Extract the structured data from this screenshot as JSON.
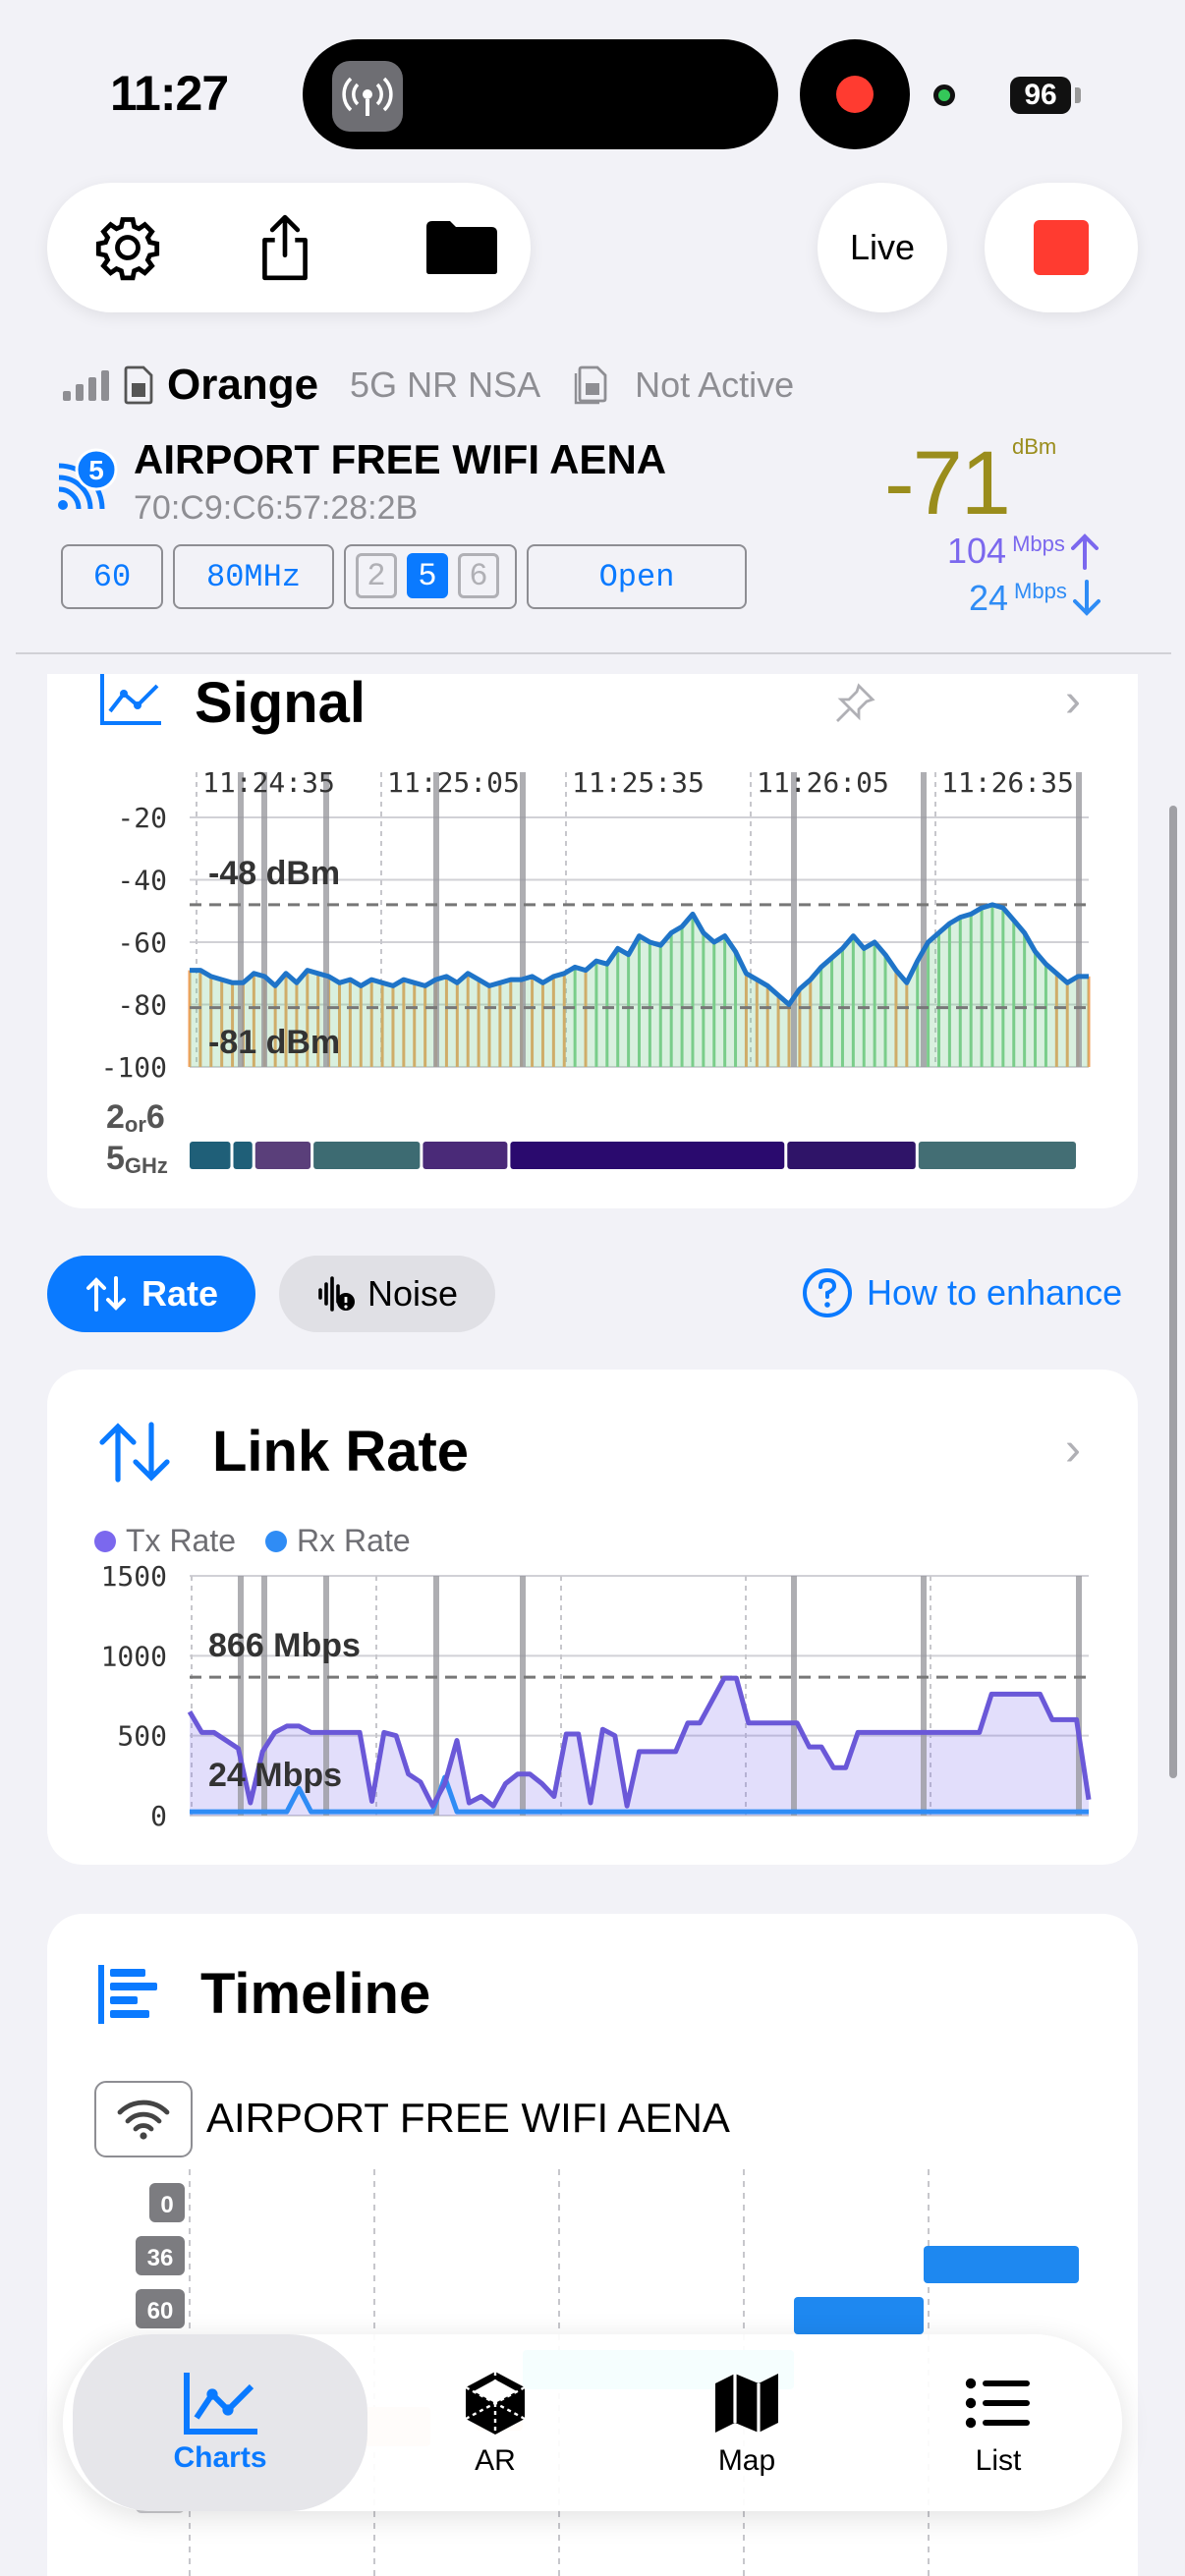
{
  "status_bar": {
    "time": "11:27",
    "battery": "96"
  },
  "toolbar": {
    "settings_icon": "gear-icon",
    "share_icon": "share-icon",
    "folder_icon": "folder-icon",
    "live_label": "Live",
    "stop_icon": "stop-icon"
  },
  "cellular": {
    "carrier": "Orange",
    "technology": "5G NR NSA",
    "sim_status": "Not Active"
  },
  "wifi": {
    "generation_badge": "5",
    "ssid": "AIRPORT FREE WIFI AENA",
    "bssid": "70:C9:C6:57:28:2B",
    "channel": "60",
    "width": "80MHz",
    "bands": [
      "2",
      "5",
      "6"
    ],
    "active_band": "5",
    "security": "Open",
    "rssi": "-71",
    "rssi_unit": "dBm",
    "tx_rate": "104",
    "rx_rate": "24",
    "rate_unit": "Mbps",
    "colors": {
      "rssi": "#9a8d1c",
      "tx": "#7b68ee",
      "rx": "#2f8cf5"
    }
  },
  "signal_card": {
    "title": "Signal",
    "band_label_top": "2",
    "band_label_or": "or",
    "band_label_six": "6",
    "band_label_bottom": "5",
    "band_label_unit": "GHz",
    "max_label": "-48 dBm",
    "min_label": "-81 dBm",
    "band_segments": [
      {
        "color": "#1f5f78",
        "span": 6
      },
      {
        "color": "#1f5f78",
        "span": 3
      },
      {
        "color": "#5a3f7a",
        "span": 8
      },
      {
        "color": "#3d6b72",
        "span": 15
      },
      {
        "color": "#4a2a78",
        "span": 12
      },
      {
        "color": "#2a0a6e",
        "span": 38
      },
      {
        "color": "#2f1468",
        "span": 18
      },
      {
        "color": "#436e74",
        "span": 22
      }
    ]
  },
  "chart_data": [
    {
      "type": "area",
      "title": "Signal",
      "x_ticks": [
        "11:24:35",
        "11:25:05",
        "11:25:35",
        "11:26:05",
        "11:26:35"
      ],
      "y_ticks": [
        "-20",
        "-40",
        "-60",
        "-80",
        "-100"
      ],
      "ylim": [
        -100,
        -20
      ],
      "series": [
        {
          "values": [
            -69,
            -69,
            -71,
            -72,
            -73,
            -73,
            -70,
            -71,
            -74,
            -70,
            -73,
            -69,
            -70,
            -71,
            -73,
            -72,
            -74,
            -72,
            -73,
            -74,
            -72,
            -73,
            -74,
            -72,
            -71,
            -73,
            -70,
            -72,
            -74,
            -73,
            -72,
            -72,
            -71,
            -73,
            -71,
            -70,
            -68,
            -69,
            -66,
            -67,
            -62,
            -64,
            -58,
            -60,
            -61,
            -57,
            -55,
            -51,
            -57,
            -60,
            -58,
            -63,
            -70,
            -72,
            -74,
            -77,
            -80,
            -75,
            -72,
            -68,
            -65,
            -62,
            -58,
            -62,
            -60,
            -64,
            -69,
            -73,
            -66,
            -60,
            -57,
            -54,
            -52,
            -51,
            -49,
            -48,
            -49,
            -53,
            -57,
            -63,
            -67,
            -70,
            -73,
            -71,
            -71
          ],
          "color": "#1f74c8"
        }
      ],
      "reference_lines": [
        -48,
        -81
      ]
    },
    {
      "type": "area",
      "title": "Link Rate",
      "y_ticks": [
        "1500",
        "1000",
        "500",
        "0"
      ],
      "ylim": [
        0,
        1500
      ],
      "series": [
        {
          "name": "Tx Rate",
          "values": [
            650,
            520,
            520,
            470,
            420,
            80,
            400,
            520,
            560,
            560,
            520,
            520,
            520,
            520,
            520,
            90,
            520,
            500,
            260,
            210,
            60,
            200,
            470,
            80,
            120,
            60,
            200,
            260,
            260,
            200,
            120,
            510,
            510,
            80,
            540,
            500,
            60,
            400,
            400,
            400,
            400,
            580,
            580,
            720,
            860,
            860,
            580,
            580,
            580,
            580,
            580,
            430,
            430,
            300,
            300,
            520,
            520,
            520,
            520,
            520,
            520,
            520,
            520,
            520,
            520,
            520,
            760,
            760,
            760,
            760,
            760,
            600,
            600,
            600,
            100
          ],
          "color": "#6a58d8"
        },
        {
          "name": "Rx Rate",
          "values": [
            24,
            24,
            24,
            24,
            24,
            24,
            24,
            24,
            24,
            170,
            24,
            24,
            24,
            24,
            24,
            24,
            24,
            24,
            24,
            24,
            24,
            240,
            24,
            24,
            24,
            24,
            24,
            24,
            24,
            24,
            24,
            24,
            24,
            24,
            24,
            24,
            24,
            24,
            24,
            24,
            24,
            24,
            24,
            24,
            24,
            24,
            24,
            24,
            24,
            24,
            24,
            24,
            24,
            24,
            24,
            24,
            24,
            24,
            24,
            24,
            24,
            24,
            24,
            24,
            24,
            24,
            24,
            24,
            24,
            24,
            24,
            24,
            24,
            24,
            24
          ],
          "color": "#2f8cf5"
        }
      ],
      "reference_lines": [
        866,
        24
      ]
    }
  ],
  "rate_card": {
    "title": "Link Rate",
    "tx_legend": "Tx Rate",
    "rx_legend": "Rx Rate",
    "max_label": "866 Mbps",
    "min_label": "24 Mbps"
  },
  "pills": {
    "rate": "Rate",
    "noise": "Noise",
    "enhance": "How to enhance"
  },
  "timeline_card": {
    "title": "Timeline",
    "network_name": "AIRPORT FREE WIFI AENA",
    "channel_labels": [
      "0",
      "36",
      "60",
      "60"
    ]
  },
  "tabbar": {
    "tabs": [
      {
        "label": "Charts",
        "icon": "chart-icon",
        "active": true
      },
      {
        "label": "AR",
        "icon": "ar-cube-icon",
        "active": false
      },
      {
        "label": "Map",
        "icon": "map-icon",
        "active": false
      },
      {
        "label": "List",
        "icon": "list-icon",
        "active": false
      }
    ]
  }
}
